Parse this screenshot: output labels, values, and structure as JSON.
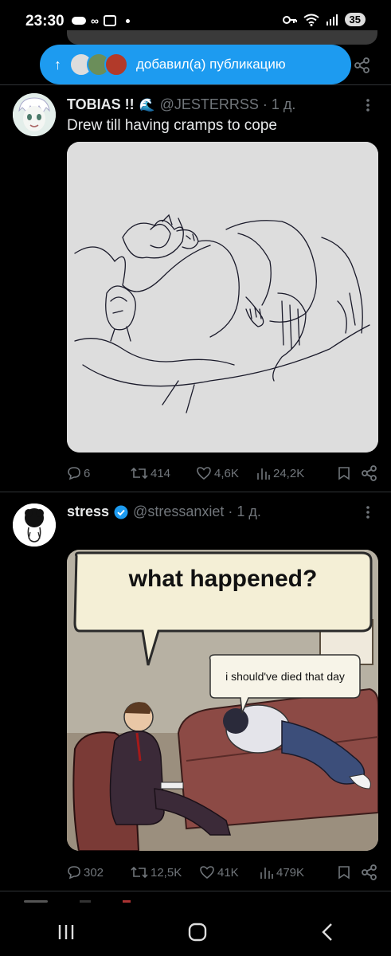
{
  "status_bar": {
    "time": "23:30",
    "battery": "35"
  },
  "new_posts_pill": {
    "arrow": "↑",
    "label": "добавил(а) публикацию"
  },
  "tweets": [
    {
      "name": "TOBIAS !!",
      "emoji": "🌊",
      "handle": "@JESTERRSS",
      "time": "· 1 д.",
      "text": "Drew till having cramps to cope",
      "replies": "6",
      "reposts": "414",
      "likes": "4,6K",
      "views": "24,2K"
    },
    {
      "name": "stress",
      "handle": "@stressanxiet",
      "time": "· 1 д.",
      "meme_top": "what happened?",
      "meme_reply": "i should've died that day",
      "replies": "302",
      "reposts": "12,5K",
      "likes": "41K",
      "views": "479K"
    }
  ],
  "colors": {
    "accent": "#1d9bf0",
    "muted": "#71767b",
    "verified": "#1d9bf0"
  },
  "nav": {
    "recent": "III",
    "home": "O",
    "back": "<"
  }
}
